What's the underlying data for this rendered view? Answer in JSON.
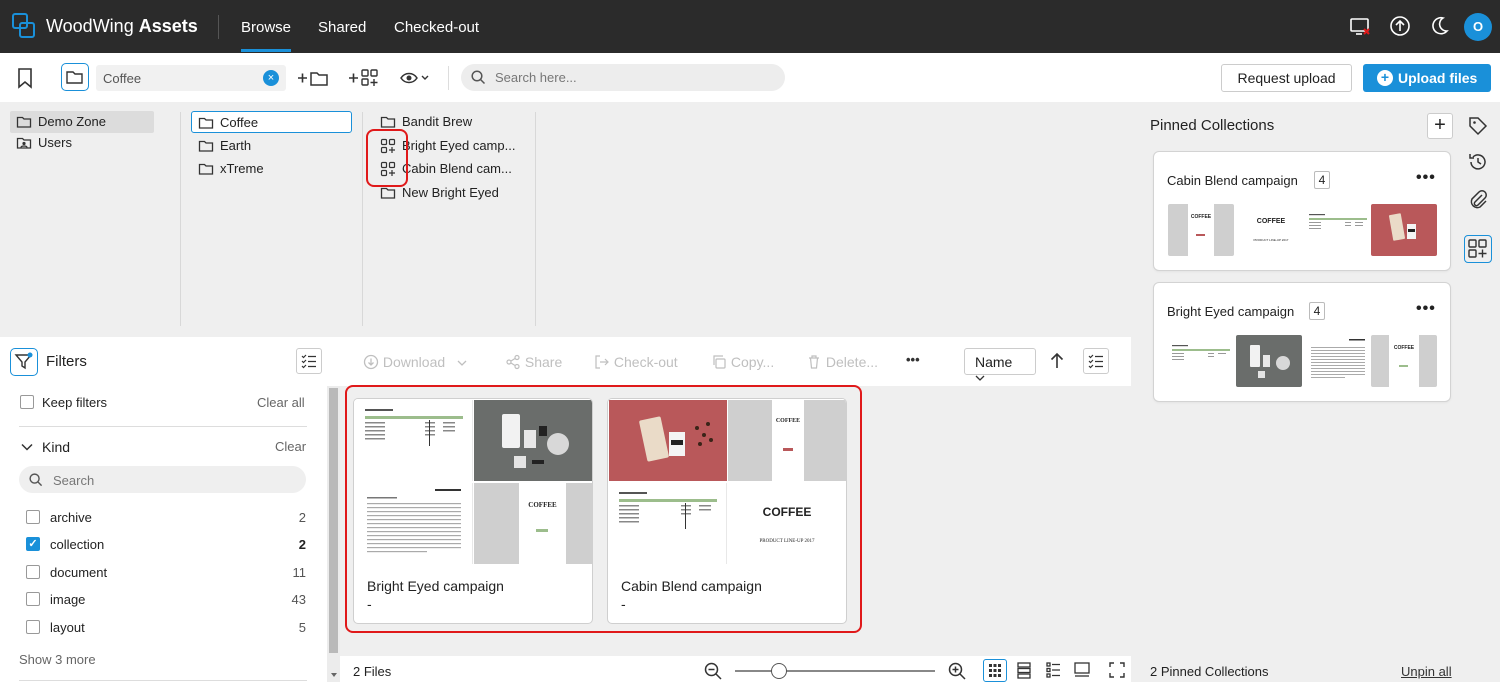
{
  "topbar": {
    "brand_light": "WoodWing",
    "brand_bold": "Assets",
    "tabs": [
      {
        "label": "Browse",
        "active": true
      },
      {
        "label": "Shared"
      },
      {
        "label": "Checked-out"
      }
    ],
    "avatar_initial": "O",
    "accent_color": "#1a90d9"
  },
  "toolbar": {
    "path_value": "Coffee",
    "search_placeholder": "Search here...",
    "request_upload": "Request upload",
    "upload_files": "Upload files",
    "new_folder_plus": "+",
    "new_collection_plus": "+"
  },
  "browser": {
    "col1": [
      {
        "label": "Demo Zone",
        "icon": "folder-icon"
      },
      {
        "label": "Users",
        "icon": "users-folder-icon"
      }
    ],
    "col2": [
      {
        "label": "Coffee",
        "icon": "folder-icon"
      },
      {
        "label": "Earth",
        "icon": "folder-icon"
      },
      {
        "label": "xTreme",
        "icon": "folder-icon"
      }
    ],
    "col3": [
      {
        "label": "Bandit Brew",
        "icon": "folder-icon"
      },
      {
        "label": "Bright Eyed camp...",
        "icon": "collection-icon"
      },
      {
        "label": "Cabin Blend cam...",
        "icon": "collection-icon"
      },
      {
        "label": "New Bright Eyed",
        "icon": "folder-icon"
      }
    ]
  },
  "filters": {
    "title": "Filters",
    "keep_filters": "Keep filters",
    "clear_all": "Clear all",
    "kind_label": "Kind",
    "kind_clear": "Clear",
    "kind_search_placeholder": "Search",
    "kinds": [
      {
        "label": "archive",
        "count": "2",
        "checked": false
      },
      {
        "label": "collection",
        "count": "2",
        "checked": true
      },
      {
        "label": "document",
        "count": "11",
        "checked": false
      },
      {
        "label": "image",
        "count": "43",
        "checked": false
      },
      {
        "label": "layout",
        "count": "5",
        "checked": false
      }
    ],
    "show_more": "Show 3 more"
  },
  "actions": {
    "download": "Download",
    "share": "Share",
    "checkout": "Check-out",
    "copy": "Copy...",
    "delete": "Delete...",
    "more": "•••",
    "sort": "Name"
  },
  "cards": [
    {
      "name": "Bright Eyed campaign",
      "sub": "-"
    },
    {
      "name": "Cabin Blend campaign",
      "sub": "-"
    }
  ],
  "thumb_text": {
    "coffee": "COFFEE",
    "lineup": "PRODUCT LINE-UP 2017"
  },
  "statusbar": {
    "files": "2 Files"
  },
  "pinned": {
    "title": "Pinned Collections",
    "add": "+",
    "collections": [
      {
        "name": "Cabin Blend campaign",
        "count": "4",
        "more": "•••"
      },
      {
        "name": "Bright Eyed campaign",
        "count": "4",
        "more": "•••"
      }
    ],
    "footer_count": "2 Pinned Collections",
    "unpin_all": "Unpin all"
  }
}
